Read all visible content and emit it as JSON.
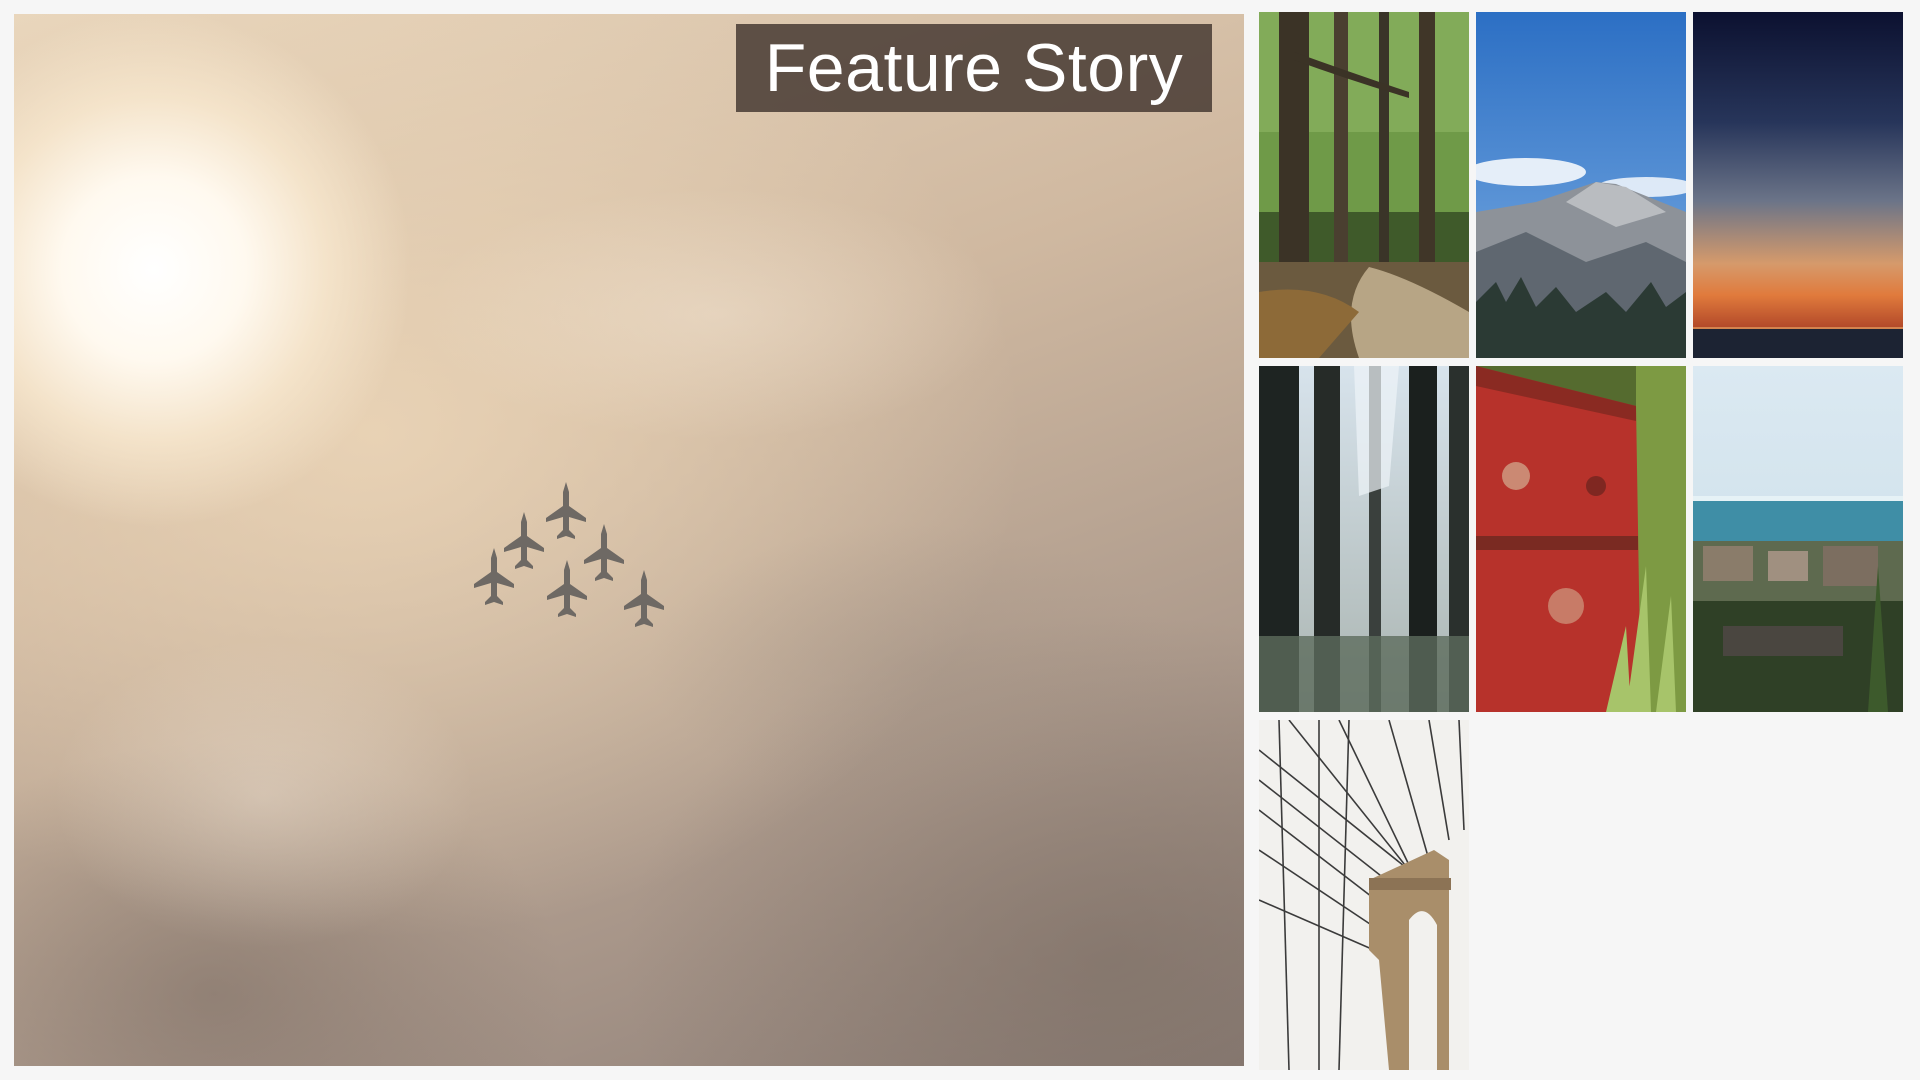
{
  "feature": {
    "title": "Feature Story",
    "image_icon": "jets-formation-photo"
  },
  "gallery": {
    "thumbnails": [
      {
        "icon": "forest-path-photo"
      },
      {
        "icon": "mountain-peak-photo"
      },
      {
        "icon": "sunset-sea-photo"
      },
      {
        "icon": "tall-trees-photo"
      },
      {
        "icon": "rusty-barrel-photo"
      },
      {
        "icon": "coastal-town-photo"
      },
      {
        "icon": "suspension-bridge-photo"
      }
    ]
  },
  "colors": {
    "page_background": "#f6f6f6",
    "badge_background": "#463a32",
    "badge_text": "#ffffff"
  }
}
